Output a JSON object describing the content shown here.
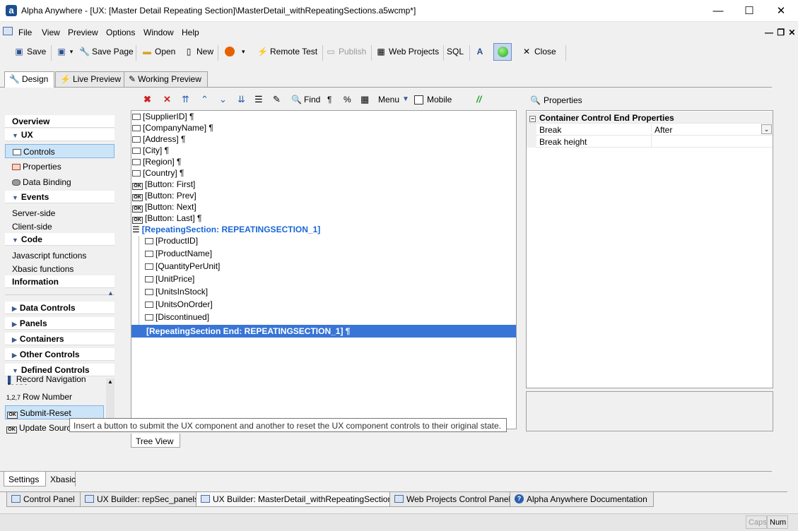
{
  "window": {
    "title": "Alpha Anywhere - [UX: [Master Detail Repeating Section]\\MasterDetail_withRepeatingSections.a5wcmp*]",
    "logo_letter": "a",
    "minimize": "—",
    "maximize": "☐",
    "close": "✕",
    "mdi_controls": "— ❐ ✕"
  },
  "menu": [
    "File",
    "View",
    "Preview",
    "Options",
    "Window",
    "Help"
  ],
  "toolbar": {
    "save": "Save",
    "save_page": "Save Page",
    "open": "Open",
    "new": "New",
    "remote_test": "Remote Test",
    "publish": "Publish",
    "web_projects": "Web Projects",
    "sql": "SQL",
    "close": "Close"
  },
  "mode_tabs": [
    "Design",
    "Live Preview",
    "Working Preview"
  ],
  "nav": {
    "overview": "Overview",
    "ux": "UX",
    "controls": "Controls",
    "properties": "Properties",
    "data_binding": "Data Binding",
    "events": "Events",
    "server_side": "Server-side",
    "client_side": "Client-side",
    "code": "Code",
    "js_functions": "Javascript functions",
    "xbasic_functions": "Xbasic functions",
    "information": "Information",
    "data_controls": "Data Controls",
    "panels": "Panels",
    "containers": "Containers",
    "other_controls": "Other Controls",
    "defined_controls": "Defined Controls",
    "record_nav_icons": "Record Navigation Icons",
    "row_number": "Row Number",
    "submit_reset": "Submit-Reset",
    "update_source": "Update Source"
  },
  "editor_toolbar": {
    "find": "Find",
    "menu": "Menu",
    "mobile": "Mobile",
    "pilcrow": "¶",
    "percent": "%",
    "slashes": "//"
  },
  "tree": {
    "items": [
      "[SupplierID] ¶",
      "[CompanyName] ¶",
      "[Address] ¶",
      "[City] ¶",
      "[Region] ¶",
      "[Country] ¶",
      "[Button: First]",
      "[Button: Prev]",
      "[Button: Next]",
      "[Button: Last] ¶"
    ],
    "repeating_section": "[RepeatingSection: REPEATINGSECTION_1]",
    "children": [
      "[ProductID]",
      "[ProductName]",
      "[QuantityPerUnit]",
      "[UnitPrice]",
      "[UnitsInStock]",
      "[UnitsOnOrder]",
      "[Discontinued]"
    ],
    "section_end": "[RepeatingSection End: REPEATINGSECTION_1] ¶",
    "tree_view_tab": "Tree View"
  },
  "properties": {
    "header": "Properties",
    "group": "Container Control End Properties",
    "break_label": "Break",
    "break_value": "After",
    "break_height_label": "Break height",
    "break_height_value": ""
  },
  "tooltip": "Insert a button to submit the UX component and another to reset the UX component controls to their original state.",
  "bottom_left_tabs": [
    "Settings",
    "Xbasic"
  ],
  "bottom_tabs": [
    "Control Panel",
    "UX Builder: repSec_panels",
    "UX Builder: MasterDetail_withRepeatingSections*",
    "Web Projects Control Panel",
    "Alpha Anywhere Documentation"
  ],
  "status": {
    "caps": "Caps",
    "num": "Num"
  },
  "colors": {
    "selection": "#3875d7",
    "repeating_section": "#1a66d6",
    "nav_selected": "#cce4f7"
  }
}
